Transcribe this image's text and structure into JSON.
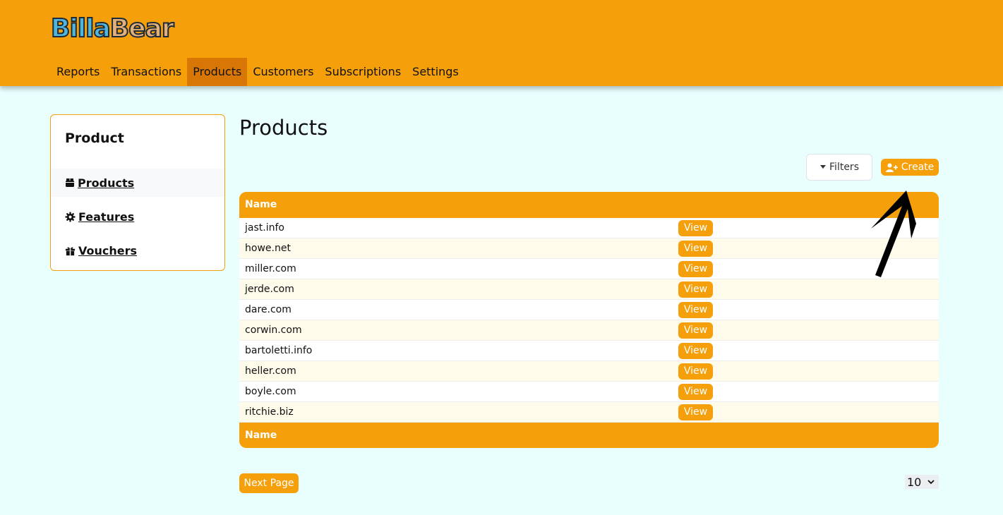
{
  "brand": {
    "part1": "Billa",
    "part2": "Bear"
  },
  "nav": {
    "items": [
      {
        "label": "Reports"
      },
      {
        "label": "Transactions"
      },
      {
        "label": "Products",
        "active": true
      },
      {
        "label": "Customers"
      },
      {
        "label": "Subscriptions"
      },
      {
        "label": "Settings"
      }
    ]
  },
  "sidebar": {
    "title": "Product",
    "items": [
      {
        "label": " Products",
        "icon": "box-icon",
        "active": true
      },
      {
        "label": " Features",
        "icon": "gear-icon"
      },
      {
        "label": " Vouchers",
        "icon": "gift-icon"
      }
    ]
  },
  "main": {
    "title": "Products",
    "filters_label": "Filters",
    "create_label": "Create",
    "table": {
      "header": "Name",
      "footer": "Name",
      "view_label": "View",
      "rows": [
        "jast.info",
        "howe.net",
        "miller.com",
        "jerde.com",
        "dare.com",
        "corwin.com",
        "bartoletti.info",
        "heller.com",
        "boyle.com",
        "ritchie.biz"
      ]
    },
    "next_page_label": "Next Page",
    "page_size": "10"
  },
  "colors": {
    "accent": "#f59f0b",
    "accent_dark": "#d97706",
    "background": "#e8fffe"
  }
}
